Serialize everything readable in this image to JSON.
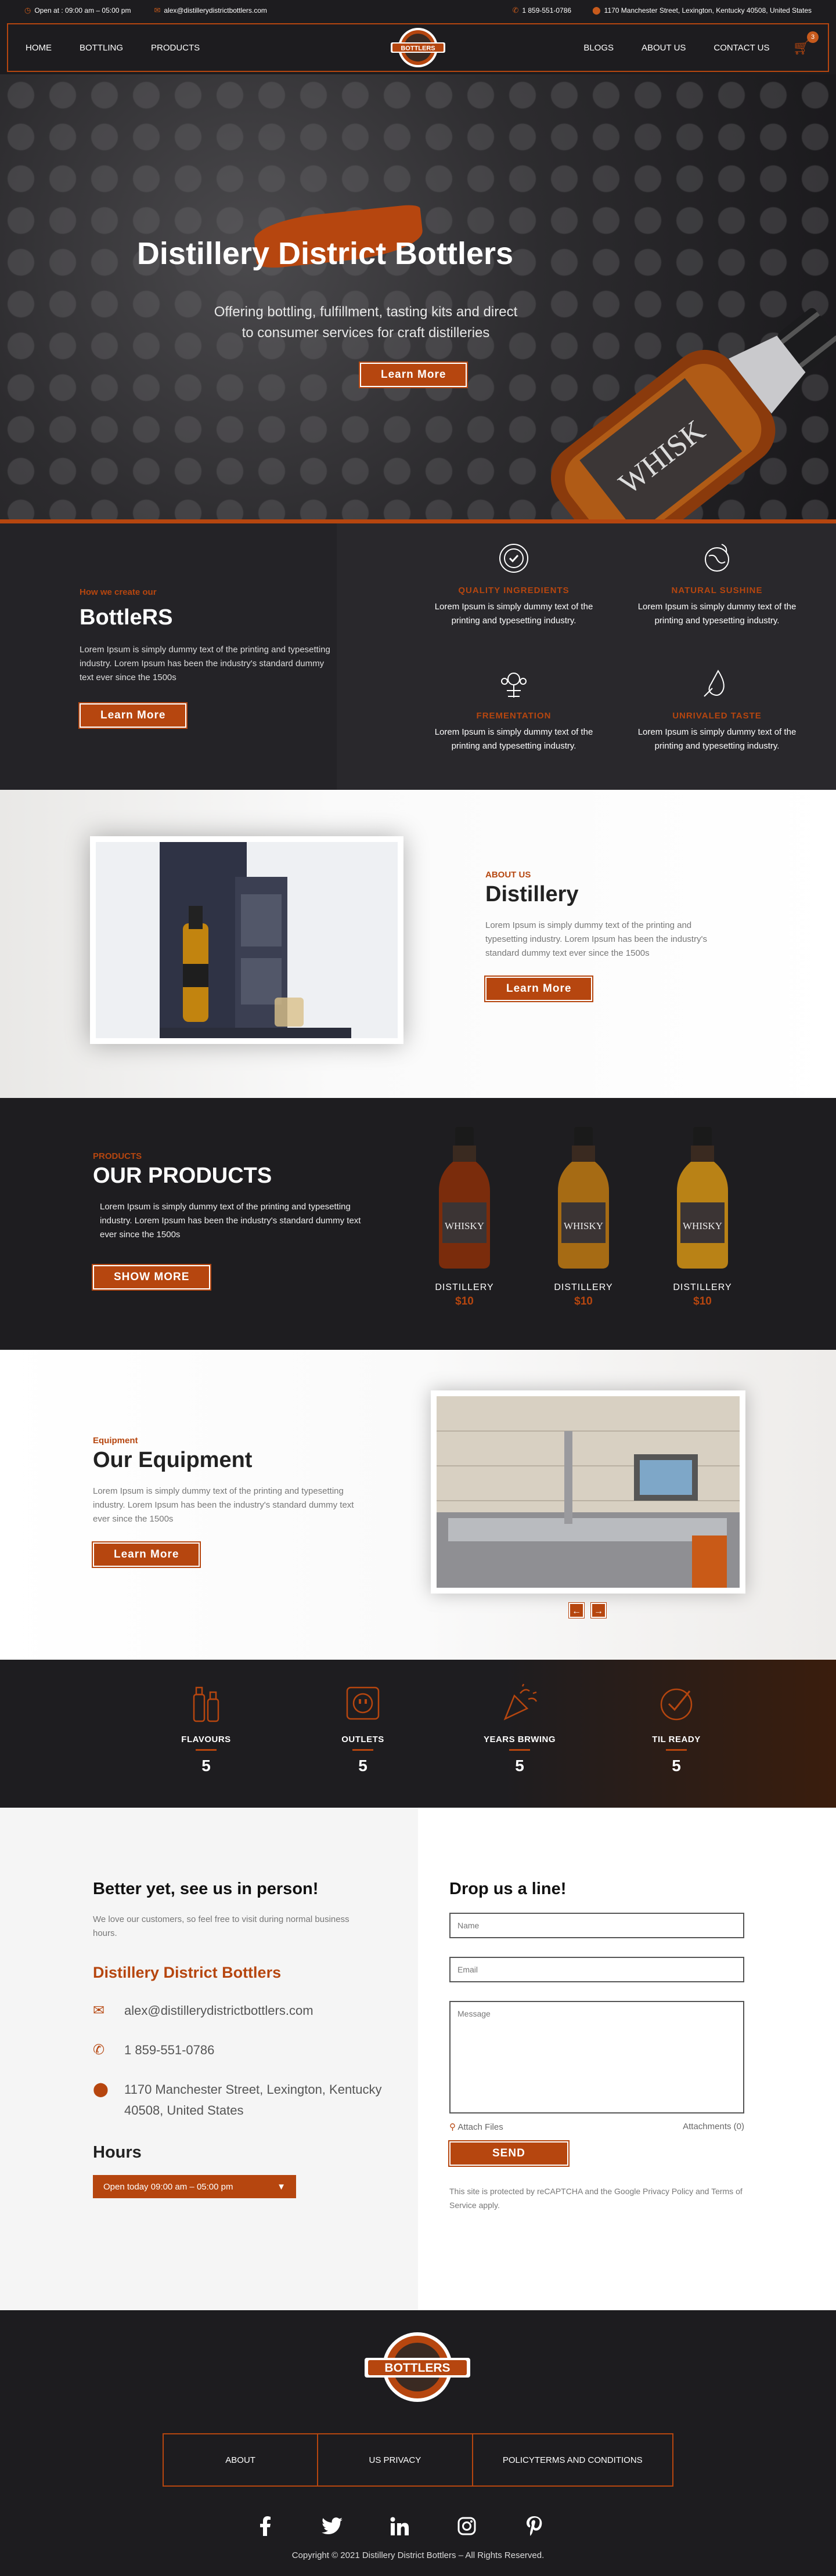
{
  "topbar": {
    "hours": "Open at : 09:00 am – 05:00 pm",
    "email": "alex@distillerydistrictbottlers.com",
    "phone": "1 859-551-0786",
    "address": "1170 Manchester Street, Lexington, Kentucky 40508, United States"
  },
  "nav": {
    "left": [
      "HOME",
      "BOTTLING",
      "PRODUCTS"
    ],
    "right": [
      "BLOGS",
      "ABOUT US",
      "CONTACT US"
    ],
    "cart_count": "3",
    "logo_text": "BOTTLERS"
  },
  "hero": {
    "title": "Distillery District Bottlers",
    "subtitle": "Offering bottling, fulfillment, tasting kits and direct to consumer services for craft distilleries",
    "button": "Learn More",
    "bottle_label": "WHISK"
  },
  "bottlers": {
    "kicker": "How we create our",
    "title": "BottleRS",
    "text": "Lorem Ipsum is simply dummy text of the printing and typesetting industry. Lorem Ipsum has been the industry's standard dummy text ever since the 1500s",
    "button": "Learn More",
    "features": [
      {
        "title": "QUALITY INGREDIENTS",
        "text": "Lorem Ipsum is simply dummy text of the printing and typesetting industry.",
        "icon": "quality-icon"
      },
      {
        "title": "NATURAL SUSHINE",
        "text": "Lorem Ipsum is simply dummy text of the printing and typesetting industry.",
        "icon": "globe-icon"
      },
      {
        "title": "FREMENTATION",
        "text": "Lorem Ipsum is simply dummy text of the printing and typesetting industry.",
        "icon": "fermentation-icon"
      },
      {
        "title": "UNRIVALED TASTE",
        "text": "Lorem Ipsum is simply dummy text of the printing and typesetting industry.",
        "icon": "drop-icon"
      }
    ]
  },
  "about": {
    "kicker": "ABOUT US",
    "title": "Distillery",
    "text": "Lorem Ipsum is simply dummy text of the printing and typesetting industry. Lorem Ipsum has been the industry's standard dummy text ever since the 1500s",
    "button": "Learn More"
  },
  "products": {
    "kicker": "PRODUCTS",
    "title": "OUR PRODUCTS",
    "text": "Lorem Ipsum is simply dummy text of the printing and typesetting industry. Lorem Ipsum has been the industry's standard dummy text ever since the 1500s",
    "button": "SHOW MORE",
    "items": [
      {
        "name": "DISTILLERY",
        "price": "$10",
        "label": "WHISKY"
      },
      {
        "name": "DISTILLERY",
        "price": "$10",
        "label": "WHISKY"
      },
      {
        "name": "DISTILLERY",
        "price": "$10",
        "label": "WHISKY"
      }
    ]
  },
  "equipment": {
    "kicker": "Equipment",
    "title": "Our Equipment",
    "text": "Lorem Ipsum is simply dummy text of the printing and typesetting industry. Lorem Ipsum has been the industry's standard dummy text ever since the 1500s",
    "button": "Learn More",
    "prev": "←",
    "next": "→"
  },
  "stats": [
    {
      "label": "FLAVOURS",
      "value": "5",
      "icon": "bottles-icon"
    },
    {
      "label": "OUTLETS",
      "value": "5",
      "icon": "outlet-icon"
    },
    {
      "label": "YEARS BRWING",
      "value": "5",
      "icon": "celebration-icon"
    },
    {
      "label": "TIL READY",
      "value": "5",
      "icon": "check-icon"
    }
  ],
  "contact": {
    "visit_title": "Better yet, see us in person!",
    "visit_text": "We love our customers, so feel free to visit during normal business hours.",
    "company": "Distillery District Bottlers",
    "email": "alex@distillerydistrictbottlers.com",
    "phone": "1 859-551-0786",
    "address": "1170 Manchester Street, Lexington, Kentucky 40508, United States",
    "hours_title": "Hours",
    "hours_value": "Open today 09:00 am – 05:00 pm",
    "form_title": "Drop us a line!",
    "name_placeholder": "Name",
    "email_placeholder": "Email",
    "message_placeholder": "Message",
    "attach": "Attach Files",
    "attachments": "Attachments (0)",
    "send": "SEND",
    "notice": "This site is protected by reCAPTCHA and the Google Privacy Policy and Terms of Service apply."
  },
  "footer": {
    "links": [
      "ABOUT",
      "US PRIVACY",
      "POLICYTERMS AND CONDITIONS"
    ],
    "social": [
      "facebook-icon",
      "twitter-icon",
      "linkedin-icon",
      "instagram-icon",
      "pinterest-icon"
    ],
    "copyright": "Copyright © 2021 Distillery District Bottlers – All Rights Reserved."
  },
  "colors": {
    "accent": "#b6460f",
    "dark": "#1d1c1f",
    "light": "#f5f5f5"
  }
}
